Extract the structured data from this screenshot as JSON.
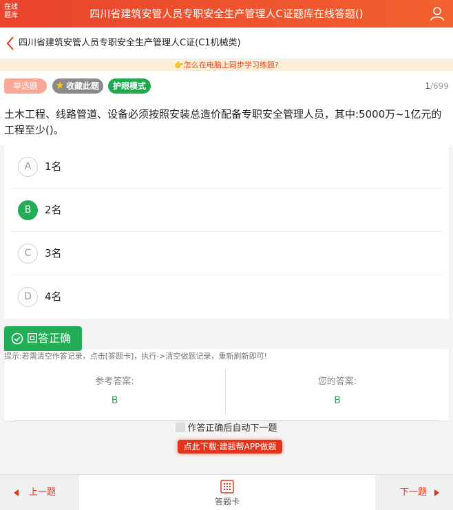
{
  "header": {
    "logo_line1": "在线",
    "logo_line2": "题库",
    "title": "四川省建筑安管人员专职安全生产管理人C证题库在线答题()"
  },
  "nav": {
    "title": "四川省建筑安管人员专职安全生产管理人C证(C1机械类)"
  },
  "tip": {
    "text": "👉怎么在电脑上同步学习练题?"
  },
  "question_meta": {
    "type_label": "单选题",
    "favorite_label": "收藏此题",
    "eye_mode_label": "护眼模式",
    "current": "1",
    "total": "/699"
  },
  "question": {
    "text": "土木工程、线路管道、设备必须按照安装总造价配备专职安全管理人员，其中:5000万~1亿元的工程至少()。",
    "options": [
      {
        "letter": "A",
        "text": "1名",
        "selected": false
      },
      {
        "letter": "B",
        "text": "2名",
        "selected": true
      },
      {
        "letter": "C",
        "text": "3名",
        "selected": false
      },
      {
        "letter": "D",
        "text": "4名",
        "selected": false
      }
    ]
  },
  "result": {
    "label": "回答正确",
    "hint": "提示:若需清空作答记录，点击[答题卡]，执行->清空做题记录，重新刷新即可!",
    "reference_label": "参考答案:",
    "reference_value": "B",
    "yours_label": "您的答案:",
    "yours_value": "B"
  },
  "auto_next_label": "作答正确后自动下一题",
  "download_label": "点此下载:建题帮APP做题",
  "bottom": {
    "prev_label": "上一题",
    "card_label": "答题卡",
    "next_label": "下一题"
  },
  "colors": {
    "brand": "#e9442c",
    "correct": "#23ad56",
    "download": "#e5341c"
  }
}
